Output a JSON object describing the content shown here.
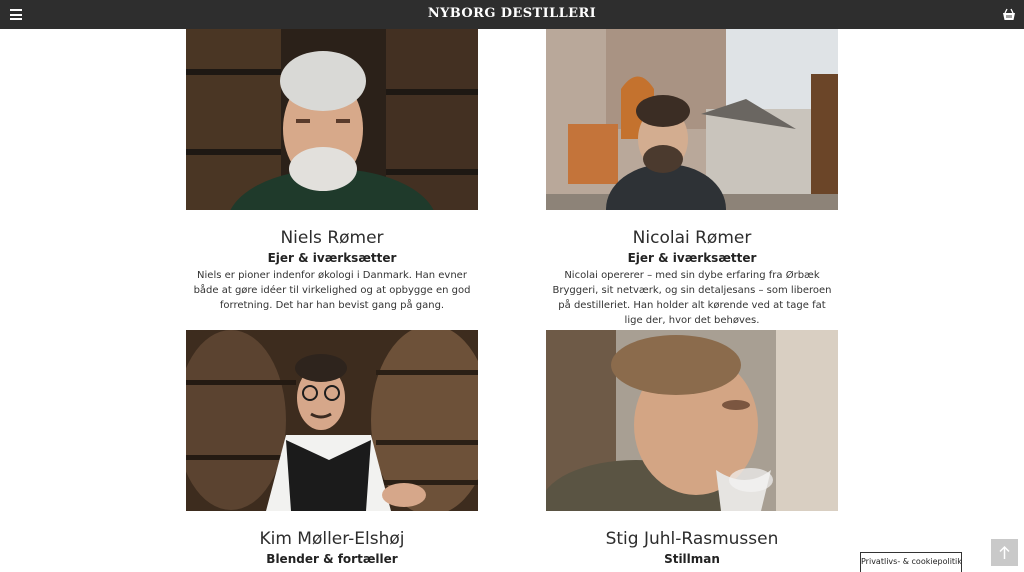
{
  "header": {
    "brand": "NYBORG DESTILLERI",
    "menu_icon": "hamburger-menu-icon",
    "cart_icon": "shopping-basket-icon",
    "background": "#2e2e2e"
  },
  "team": [
    {
      "name": "Niels Rømer",
      "role": "Ejer & iværksætter",
      "bio": "Niels er pioner indenfor økologi i Danmark. Han evner både at gøre idéer til virkelighed og at opbygge en god forretning. Det har han bevist gang på gang."
    },
    {
      "name": "Nicolai Rømer",
      "role": "Ejer & iværksætter",
      "bio": "Nicolai opererer – med sin dybe erfaring fra Ørbæk Bryggeri, sit netværk, og sin detaljesans – som liberoen på destilleriet. Han holder alt kørende ved at tage fat lige der, hvor det behøves."
    },
    {
      "name": "Kim Møller-Elshøj",
      "role": "Blender & fortæller"
    },
    {
      "name": "Stig Juhl-Rasmussen",
      "role": "Stillman"
    }
  ],
  "privacy_button": "Privatlivs- & cookiepolitik",
  "scroll_top_icon": "arrow-up-icon"
}
